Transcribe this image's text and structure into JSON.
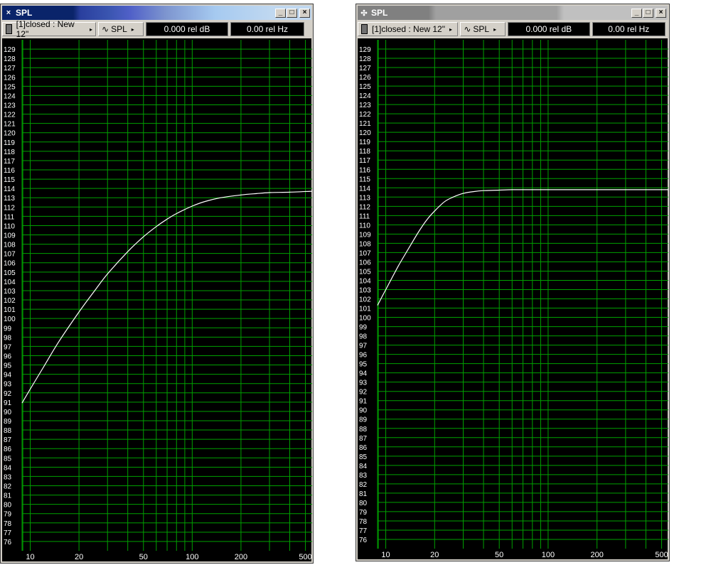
{
  "windows": [
    {
      "id": "left",
      "title": "SPL",
      "title_icon": "×",
      "active": true,
      "toolbar": {
        "project_label": "[1]closed : New 12\"",
        "view_label": "SPL",
        "readout_db": "0.000 rel dB",
        "readout_hz": "0.00 rel Hz"
      },
      "chart_data": {
        "type": "line",
        "x_scale": "log",
        "xlim": [
          8.9,
          550
        ],
        "ylim": [
          75,
          130
        ],
        "x_ticks": [
          10,
          20,
          50,
          100,
          200,
          500
        ],
        "y_ticks": [
          76,
          77,
          78,
          79,
          80,
          81,
          82,
          83,
          84,
          85,
          86,
          87,
          88,
          89,
          90,
          91,
          92,
          93,
          94,
          95,
          96,
          97,
          98,
          99,
          100,
          101,
          102,
          103,
          104,
          105,
          106,
          107,
          108,
          109,
          110,
          111,
          112,
          113,
          114,
          115,
          116,
          117,
          118,
          119,
          120,
          121,
          122,
          123,
          124,
          125,
          126,
          127,
          128,
          129
        ],
        "grid": true,
        "colors": {
          "background": "#000000",
          "grid": "#00a000",
          "line": "#ffffff",
          "text": "#ffffff"
        },
        "series": [
          {
            "x": [
              8.9,
              10,
              12,
              15,
              20,
              25,
              30,
              40,
              50,
              60,
              70,
              80,
              100,
              120,
              150,
              200,
              250,
              300,
              400,
              550
            ],
            "y": [
              90.9,
              92.4,
              94.7,
              97.5,
              100.7,
              103.0,
              104.8,
              107.2,
              108.8,
              109.9,
              110.7,
              111.3,
              112.1,
              112.6,
              113.0,
              113.3,
              113.45,
              113.55,
              113.6,
              113.7
            ]
          }
        ]
      }
    },
    {
      "id": "right",
      "title": "SPL",
      "title_icon": "✣",
      "active": false,
      "toolbar": {
        "project_label": "[1]closed : New 12\"",
        "view_label": "SPL",
        "readout_db": "0.000 rel dB",
        "readout_hz": "0.00 rel Hz"
      },
      "chart_data": {
        "type": "line",
        "x_scale": "log",
        "xlim": [
          8.9,
          550
        ],
        "ylim": [
          75,
          130
        ],
        "x_ticks": [
          10,
          20,
          50,
          100,
          200,
          500
        ],
        "y_ticks": [
          76,
          77,
          78,
          79,
          80,
          81,
          82,
          83,
          84,
          85,
          86,
          87,
          88,
          89,
          90,
          91,
          92,
          93,
          94,
          95,
          96,
          97,
          98,
          99,
          100,
          101,
          102,
          103,
          104,
          105,
          106,
          107,
          108,
          109,
          110,
          111,
          112,
          113,
          114,
          115,
          116,
          117,
          118,
          119,
          120,
          121,
          122,
          123,
          124,
          125,
          126,
          127,
          128,
          129
        ],
        "grid": true,
        "colors": {
          "background": "#000000",
          "grid": "#00a000",
          "line": "#ffffff",
          "text": "#ffffff"
        },
        "series": [
          {
            "x": [
              8.9,
              10,
              12,
              14,
              16,
              18,
              20,
              23,
              26,
              30,
              35,
              40,
              50,
              60,
              80,
              100,
              150,
              200,
              300,
              550
            ],
            "y": [
              101.3,
              103.0,
              105.6,
              107.6,
              109.3,
              110.6,
              111.5,
              112.5,
              113.0,
              113.4,
              113.6,
              113.7,
              113.75,
              113.8,
              113.8,
              113.8,
              113.8,
              113.8,
              113.8,
              113.8
            ]
          }
        ]
      }
    }
  ]
}
